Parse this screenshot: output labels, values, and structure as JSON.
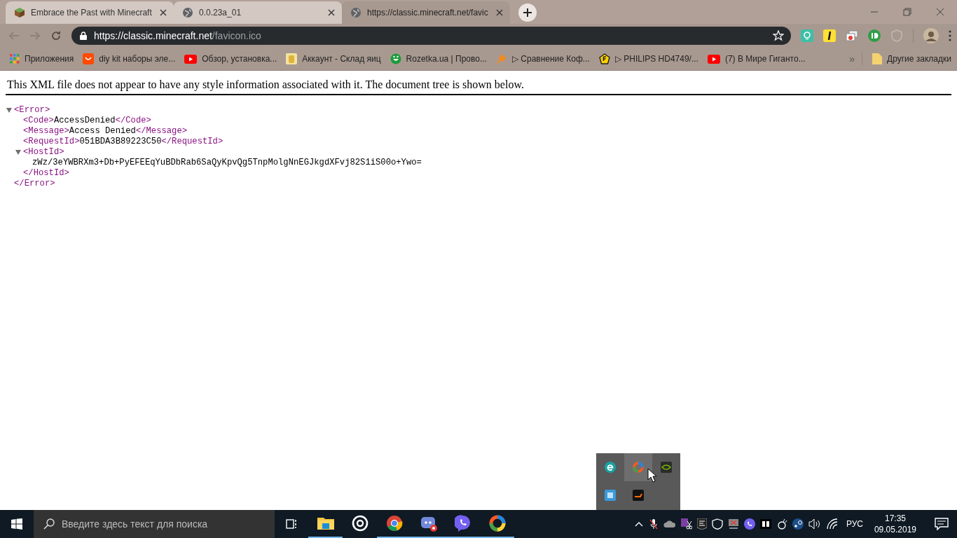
{
  "tabs": [
    {
      "label": "Embrace the Past with Minecraft",
      "selected": false
    },
    {
      "label": "0.0.23a_01",
      "selected": false
    },
    {
      "label": "https://classic.minecraft.net/favic",
      "selected": true
    }
  ],
  "address": {
    "url": "**https://classic.minecraft.net**/favicon.ico"
  },
  "bookmarks": [
    {
      "label": "Приложения"
    },
    {
      "label": "diy kit наборы эле..."
    },
    {
      "label": "Обзор, установка..."
    },
    {
      "label": "Аккаунт - Склад яиц"
    },
    {
      "label": "Rozetka.ua | Прово..."
    },
    {
      "label": "▷ Сравнение Коф..."
    },
    {
      "label": "▷ PHILIPS HD4749/..."
    },
    {
      "label": "(7) В Мире Гиганто..."
    }
  ],
  "bookmarks_more": "»",
  "other_bookmarks": "Другие закладки",
  "page": {
    "notice": "This XML file does not appear to have any style information associated with it. The document tree is shown below.",
    "tree": [
      {
        "open": "<Error>",
        "close": "</Error>",
        "expanded": true,
        "children": [
          {
            "open": "<Code>",
            "text": "AccessDenied",
            "close": "</Code>"
          },
          {
            "open": "<Message>",
            "text": "Access Denied",
            "close": "</Message>"
          },
          {
            "open": "<RequestId>",
            "text": "051BDA3B89223C50",
            "close": "</RequestId>"
          },
          {
            "open": "<HostId>",
            "close": "</HostId>",
            "expanded": true,
            "children": [
              {
                "text": "zWz/3eYWBRXm3+Db+PyEFEEqYuBDbRab6SaQyKpvQg5TnpMolgNnEGJkgdXFvj82S1iS00o+Ywo="
              }
            ]
          }
        ]
      }
    ]
  },
  "taskbar": {
    "search": {
      "placeholder": "Введите здесь текст для поиска"
    },
    "apps": [
      {
        "running": true
      },
      {
        "running": false
      },
      {
        "running": true
      },
      {
        "running": true
      },
      {
        "running": true
      },
      {
        "running": true
      }
    ],
    "language": "РУС",
    "time": "17:35",
    "date": "09.05.2019"
  }
}
